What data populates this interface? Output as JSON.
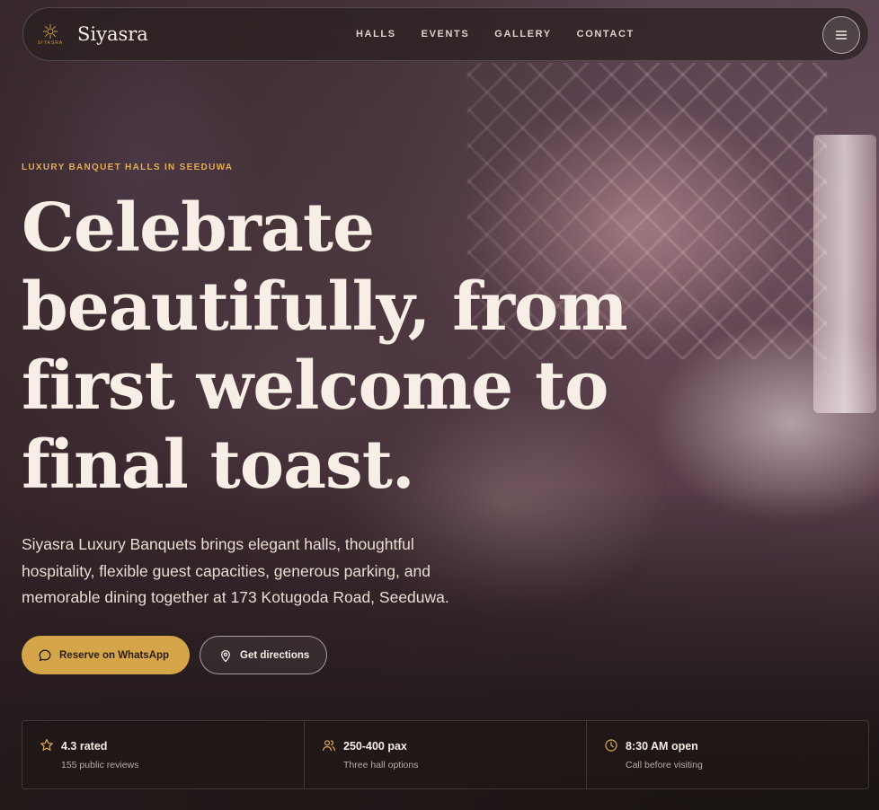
{
  "brand": {
    "logo_text": "SIYASRA",
    "name": "Siyasra"
  },
  "nav": {
    "links": [
      "HALLS",
      "EVENTS",
      "GALLERY",
      "CONTACT"
    ],
    "menu_icon": "hamburger-icon"
  },
  "hero": {
    "eyebrow": "LUXURY BANQUET HALLS IN SEEDUWA",
    "headline": "Celebrate beautifully, from first welcome to final toast.",
    "lede": "Siyasra Luxury Banquets brings elegant halls, thoughtful hospitality, flexible guest capacities, generous parking, and memorable dining together at 173 Kotugoda Road, Seeduwa.",
    "cta_primary": {
      "label": "Reserve on WhatsApp",
      "icon": "chat-bubble-icon"
    },
    "cta_secondary": {
      "label": "Get directions",
      "icon": "map-pin-icon"
    }
  },
  "stats": [
    {
      "icon": "star-icon",
      "value": "4.3 rated",
      "sub": "155 public reviews"
    },
    {
      "icon": "users-icon",
      "value": "250-400 pax",
      "sub": "Three hall options"
    },
    {
      "icon": "clock-icon",
      "value": "8:30 AM open",
      "sub": "Call before visiting"
    }
  ],
  "colors": {
    "accent": "#d5a649",
    "eyebrow": "#e2ac52",
    "text": "#f7efe5"
  }
}
